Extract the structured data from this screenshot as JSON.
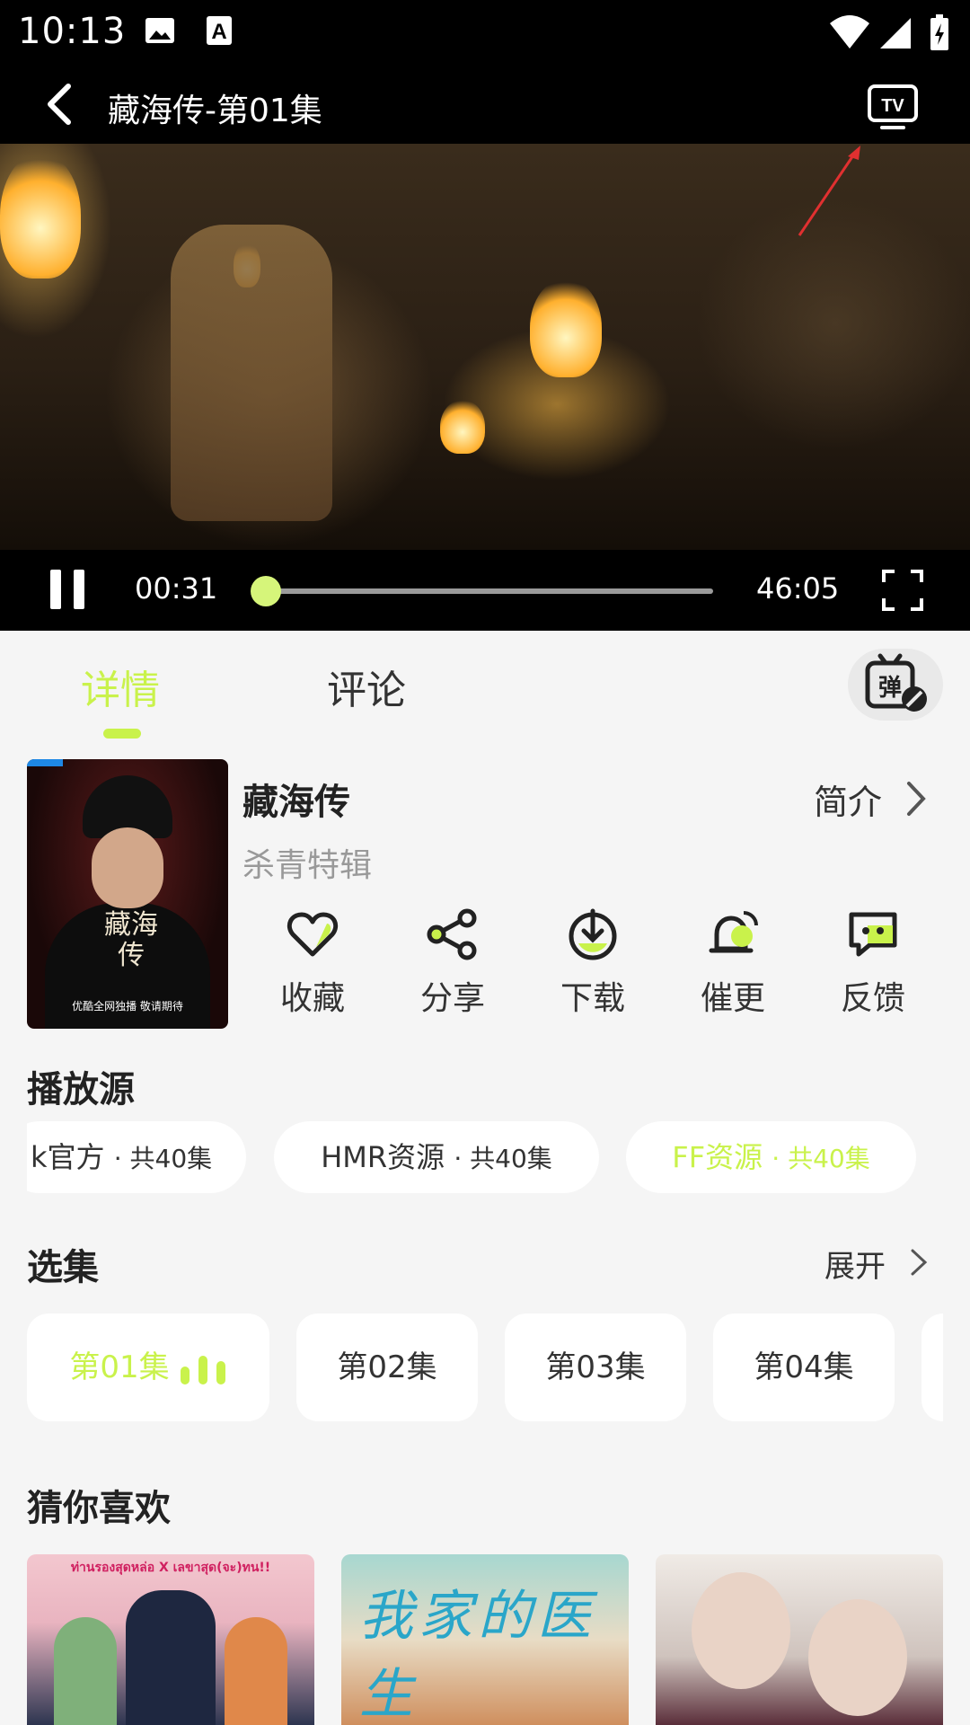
{
  "status_bar": {
    "time": "10:13",
    "icons": [
      "image-icon",
      "keyboard-a-icon",
      "wifi-icon",
      "signal-icon",
      "battery-charging-icon"
    ]
  },
  "header": {
    "title": "藏海传-第01集",
    "back_icon": "back-arrow-icon",
    "cast_icon": "tv-cast-icon"
  },
  "player": {
    "current_time": "00:31",
    "duration": "46:05",
    "progress": 0.011,
    "state": "playing"
  },
  "tabs": [
    {
      "label": "详情",
      "active": true
    },
    {
      "label": "评论",
      "active": false
    }
  ],
  "danmu_toggle_icon": "danmu-off-icon",
  "show": {
    "title": "藏海传",
    "subtitle": "杀青特辑",
    "intro_label": "简介",
    "poster": {
      "title": "藏海传",
      "footer": "优酷全网独播 敬请期待"
    }
  },
  "actions": [
    {
      "label": "收藏",
      "icon": "heart-icon"
    },
    {
      "label": "分享",
      "icon": "share-icon"
    },
    {
      "label": "下载",
      "icon": "download-icon"
    },
    {
      "label": "催更",
      "icon": "bell-icon"
    },
    {
      "label": "反馈",
      "icon": "feedback-icon"
    }
  ],
  "sources": {
    "title": "播放源",
    "items": [
      {
        "name": "k官方",
        "count": "· 共40集",
        "active": false
      },
      {
        "name": "HMR资源",
        "count": "· 共40集",
        "active": false
      },
      {
        "name": "FF资源",
        "count": "· 共40集",
        "active": true
      }
    ]
  },
  "episodes": {
    "title": "选集",
    "expand_label": "展开",
    "items": [
      {
        "label": "第01集",
        "active": true
      },
      {
        "label": "第02集",
        "active": false
      },
      {
        "label": "第03集",
        "active": false
      },
      {
        "label": "第04集",
        "active": false
      }
    ]
  },
  "recommendations": {
    "title": "猜你喜欢",
    "items": [
      {
        "banner": "ท่านรองสุดหล่อ X เลขาสุด(จะ)ทน!!"
      },
      {
        "calligraphy": "我家的医生"
      },
      {
        "poster": "portrait"
      }
    ]
  },
  "colors": {
    "accent": "#c9f24b",
    "background": "#f5f5f5",
    "card": "#ffffff",
    "text": "#333333",
    "muted": "#999999"
  }
}
